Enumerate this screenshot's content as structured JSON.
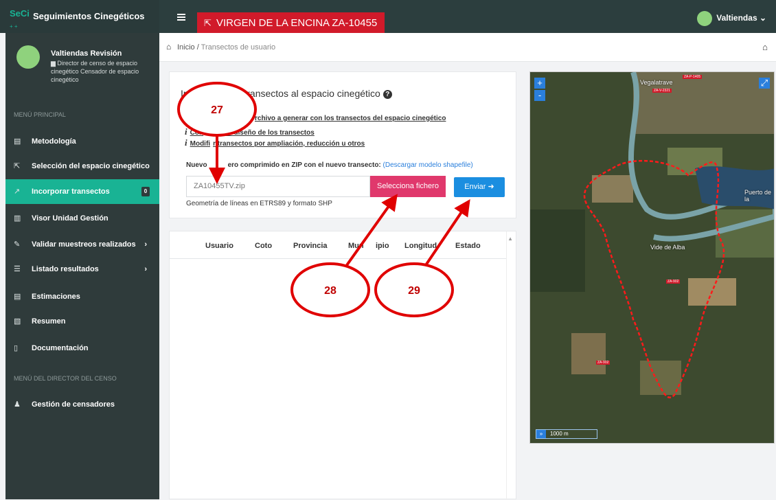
{
  "brand": {
    "logo": "SeCi",
    "title": "Seguimientos Cinegéticos",
    "mini": "+ +"
  },
  "header": {
    "estate_name": "VIRGEN DE LA ENCINA ZA-10455",
    "user": "Valtiendas ⌄"
  },
  "profile": {
    "name": "Valtiendas Revisión",
    "role": "▆ Director de censo de espacio cinegético Censador de espacio cinegético"
  },
  "sidebar": {
    "main_heading": "MENÚ PRINCIPAL",
    "items": [
      {
        "label": "Metodología",
        "icon": "document-icon",
        "glyph": "▤"
      },
      {
        "label": "Selección del espacio cinegético",
        "icon": "cursor-icon",
        "glyph": "⇱"
      },
      {
        "label": "Incorporar transectos",
        "icon": "trend-icon",
        "glyph": "↗",
        "badge": "0"
      },
      {
        "label": "Visor Unidad Gestión",
        "icon": "map-icon",
        "glyph": "▥"
      },
      {
        "label": "Validar muestreos realizados",
        "icon": "check-icon",
        "glyph": "✎"
      },
      {
        "label": "Listado resultados",
        "icon": "list-icon",
        "glyph": "☰"
      },
      {
        "label": "Estimaciones",
        "icon": "sheet-icon",
        "glyph": "▤"
      },
      {
        "label": "Resumen",
        "icon": "pdf-icon",
        "glyph": "▧"
      },
      {
        "label": "Documentación",
        "icon": "file-icon",
        "glyph": "▯"
      }
    ],
    "director_heading": "MENÚ DEL DIRECTOR DEL CENSO",
    "director_items": [
      {
        "label": "Gestión de censadores",
        "icon": "users-icon",
        "glyph": "♟"
      }
    ]
  },
  "breadcrumb": {
    "home": "Inicio",
    "separator": " / ",
    "current": "Transectos de usuario"
  },
  "card": {
    "title_start": "In",
    "title_end": "os transectos al espacio cinegético",
    "links": [
      {
        "lead": "",
        "text": "rchivo a generar con los transectos del espacio cinegético"
      },
      {
        "lead": "Con",
        "text": "de diseño de los transectos"
      },
      {
        "lead": "Modifi",
        "text": "r transectos por ampliación, reducción u otros"
      }
    ],
    "label_start": "Nuevo",
    "label_end": "ero comprimido en ZIP con el nuevo transecto:",
    "label_link": "(Descargar modelo shapefile)",
    "file_value": "ZA10455TV.zip",
    "select_button": "Selecciona fichero",
    "send_button": "Enviar ➜",
    "hint": "Geometría de líneas en ETRS89 y formato SHP"
  },
  "table": {
    "columns": [
      "Usuario",
      "Coto",
      "Provincia",
      "Mun",
      "ipio",
      "Longitud",
      "Estado"
    ]
  },
  "map": {
    "labels": [
      "Vegalatrave",
      "Vide de Alba",
      "Puerto de la",
      "ZA-P-1405",
      "ZA-V-2321",
      "ZA-902",
      "ZA-902"
    ],
    "scale": "1000 m",
    "zoom_in": "+",
    "zoom_out": "-",
    "expand": "»"
  },
  "annotations": {
    "a27": "27",
    "a28": "28",
    "a29": "29"
  }
}
